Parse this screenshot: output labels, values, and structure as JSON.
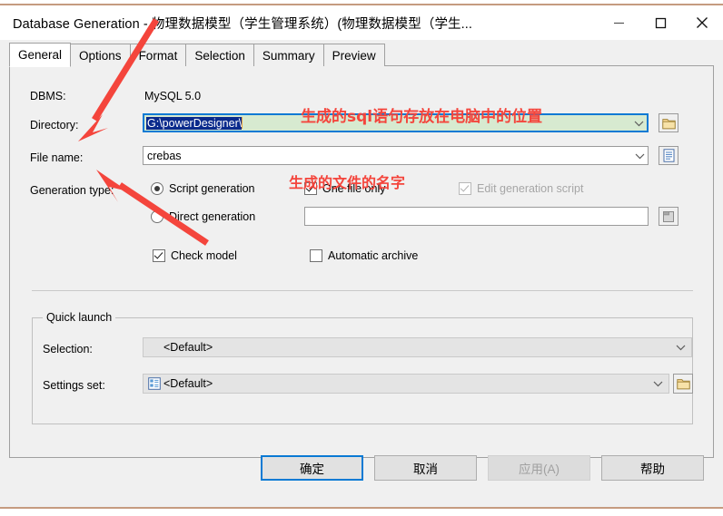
{
  "window": {
    "title": "Database Generation - 物理数据模型（学生管理系统）(物理数据模型（学生...",
    "minimize_label": "minimize",
    "maximize_label": "maximize",
    "close_label": "close",
    "accent_border": "#c59b80"
  },
  "tabs": [
    {
      "label": "General",
      "active": true
    },
    {
      "label": "Options",
      "active": false
    },
    {
      "label": "Format",
      "active": false
    },
    {
      "label": "Selection",
      "active": false
    },
    {
      "label": "Summary",
      "active": false
    },
    {
      "label": "Preview",
      "active": false
    }
  ],
  "general": {
    "dbms_label": "DBMS:",
    "dbms_value": "MySQL 5.0",
    "directory_label": "Directory:",
    "directory_value": "G:\\powerDesigner\\",
    "filename_label": "File name:",
    "filename_value": "crebas",
    "generation_type_label": "Generation type:",
    "script_generation_label": "Script generation",
    "script_generation_selected": true,
    "direct_generation_label": "Direct generation",
    "direct_generation_selected": false,
    "one_file_only_label": "One file only",
    "one_file_only_checked": true,
    "edit_generation_script_label": "Edit generation script",
    "edit_generation_script_checked": true,
    "edit_generation_script_disabled": true,
    "direct_generation_value": "",
    "check_model_label": "Check model",
    "check_model_checked": true,
    "automatic_archive_label": "Automatic archive",
    "automatic_archive_checked": false
  },
  "quick_launch": {
    "title": "Quick launch",
    "selection_label": "Selection:",
    "selection_value": "<Default>",
    "settings_set_label": "Settings set:",
    "settings_set_value": "<Default>"
  },
  "buttons": {
    "ok": "确定",
    "cancel": "取消",
    "apply": "应用(A)",
    "help": "帮助",
    "apply_disabled": true,
    "ok_is_default": true
  },
  "annotations": {
    "color": "#f4453c",
    "directory_note": "生成的sql语句存放在电脑中的位置",
    "filename_note": "生成的文件的名字"
  },
  "icons": {
    "directory_browse": "folder-icon",
    "filename_browse": "document-icon",
    "direct_generation_browse": "database-icon",
    "settings_set_browse": "folder-icon",
    "settings_set_prefix": "settings-list-icon"
  }
}
